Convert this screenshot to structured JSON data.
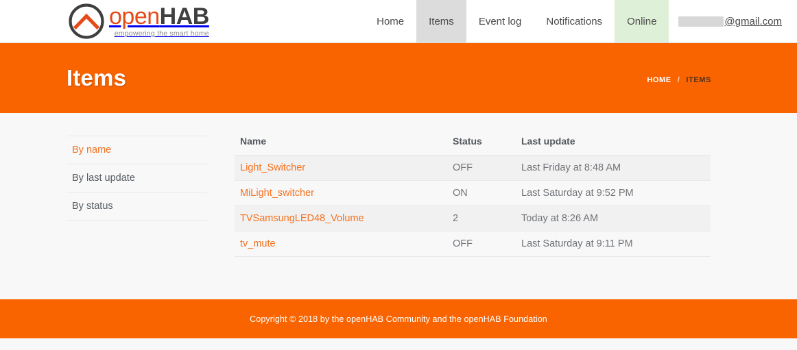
{
  "brand": {
    "logo_icon": "openhab-logo-icon",
    "name_part_open": "open",
    "name_part_hab": "HAB",
    "tagline": "empowering the smart home"
  },
  "nav": {
    "items": [
      {
        "label": "Home",
        "state": "default"
      },
      {
        "label": "Items",
        "state": "active"
      },
      {
        "label": "Event log",
        "state": "default"
      },
      {
        "label": "Notifications",
        "state": "default"
      },
      {
        "label": "Online",
        "state": "status-online"
      }
    ],
    "user": {
      "redacted": true,
      "email_suffix": "@gmail.com"
    }
  },
  "banner": {
    "title": "Items",
    "breadcrumb": {
      "home": "HOME",
      "separator": "/",
      "current": "ITEMS"
    }
  },
  "sidebar": {
    "items": [
      {
        "label": "By name",
        "state": "active"
      },
      {
        "label": "By last update",
        "state": "default"
      },
      {
        "label": "By status",
        "state": "default"
      }
    ]
  },
  "table": {
    "columns": [
      "Name",
      "Status",
      "Last update"
    ],
    "rows": [
      {
        "name": "Light_Switcher",
        "status": "OFF",
        "last_update": "Last Friday at 8:48 AM"
      },
      {
        "name": "MiLight_switcher",
        "status": "ON",
        "last_update": "Last Saturday at 9:52 PM"
      },
      {
        "name": "TVSamsungLED48_Volume",
        "status": "2",
        "last_update": "Today at 8:26 AM"
      },
      {
        "name": "tv_mute",
        "status": "OFF",
        "last_update": "Last Saturday at 9:11 PM"
      }
    ]
  },
  "footer": {
    "copyright": "Copyright © 2018 by the openHAB Community and the openHAB Foundation"
  },
  "colors": {
    "brand_orange": "#fa6400",
    "link_orange": "#f4711f",
    "logo_dark": "#3f3f3f",
    "nav_active_bg": "#dcdcdc",
    "status_online_bg": "#dff0d8",
    "content_bg": "#f8f8f8",
    "row_stripe_bg": "#f1f1f1"
  }
}
